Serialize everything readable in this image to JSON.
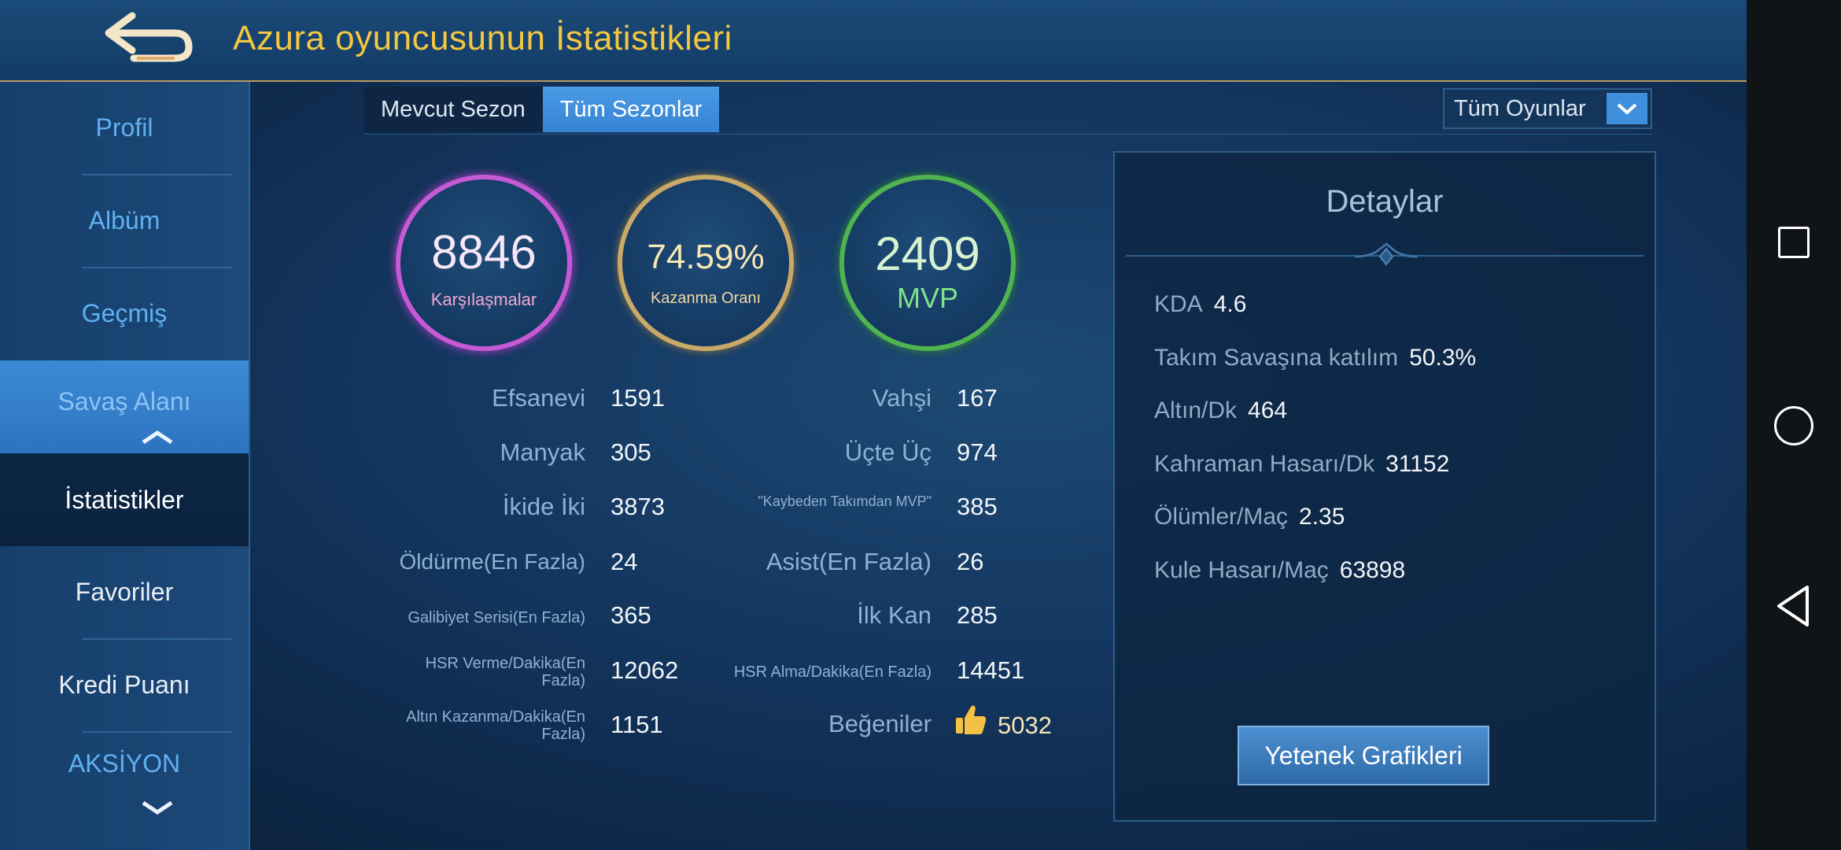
{
  "header": {
    "title": "Azurа oyuncusunun İstatistikleri"
  },
  "icons": {
    "back": "back-arrow-icon",
    "dropdown": "chevron-down-icon",
    "like": "thumbs-up-icon"
  },
  "sidebar": {
    "items": [
      {
        "label": "Profil"
      },
      {
        "label": "Albüm"
      },
      {
        "label": "Geçmiş"
      },
      {
        "label": "Savaş Alanı"
      },
      {
        "label": "İstatistikler"
      },
      {
        "label": "Favoriler"
      },
      {
        "label": "Kredi Puanı"
      },
      {
        "label": "AKSİYON"
      }
    ]
  },
  "tabs": [
    {
      "label": "Mevcut Sezon"
    },
    {
      "label": "Tüm Sezonlar"
    }
  ],
  "filter": {
    "label": "Tüm Oyunlar"
  },
  "circles": {
    "matches": {
      "value": "8846",
      "label": "Karşılaşmalar"
    },
    "winrate": {
      "value": "74.59%",
      "label": "Kazanma Oranı"
    },
    "mvp": {
      "value": "2409",
      "label": "MVP"
    }
  },
  "stats": {
    "left": [
      {
        "label": "Efsanevi",
        "value": "1591"
      },
      {
        "label": "Manyak",
        "value": "305"
      },
      {
        "label": "İkide İki",
        "value": "3873"
      },
      {
        "label": "Öldürme(En Fazla)",
        "value": "24"
      },
      {
        "label": "Galibiyet Serisi(En Fazla)",
        "value": "365"
      },
      {
        "label": "HSR Verme/Dakika(En Fazla)",
        "value": "12062"
      },
      {
        "label": "Altın Kazanma/Dakika(En Fazla)",
        "value": "1151"
      }
    ],
    "right": [
      {
        "label": "Vahşi",
        "value": "167"
      },
      {
        "label": "Üçte Üç",
        "value": "974"
      },
      {
        "label": "\"Kaybeden Takımdan MVP\"",
        "value": "385"
      },
      {
        "label": "Asist(En Fazla)",
        "value": "26"
      },
      {
        "label": "İlk Kan",
        "value": "285"
      },
      {
        "label": "HSR Alma/Dakika(En Fazla)",
        "value": "14451"
      },
      {
        "label": "Beğeniler",
        "value": "5032"
      }
    ]
  },
  "details": {
    "title": "Detaylar",
    "rows": [
      {
        "label": "KDA",
        "value": "4.6"
      },
      {
        "label": "Takım Savaşına katılım",
        "value": "50.3%"
      },
      {
        "label": "Altın/Dk",
        "value": "464"
      },
      {
        "label": "Kahraman Hasarı/Dk",
        "value": "31152"
      },
      {
        "label": "Ölümler/Maç",
        "value": "2.35"
      },
      {
        "label": "Kule Hasarı/Maç",
        "value": "63898"
      }
    ],
    "button": "Yetenek Grafikleri"
  }
}
